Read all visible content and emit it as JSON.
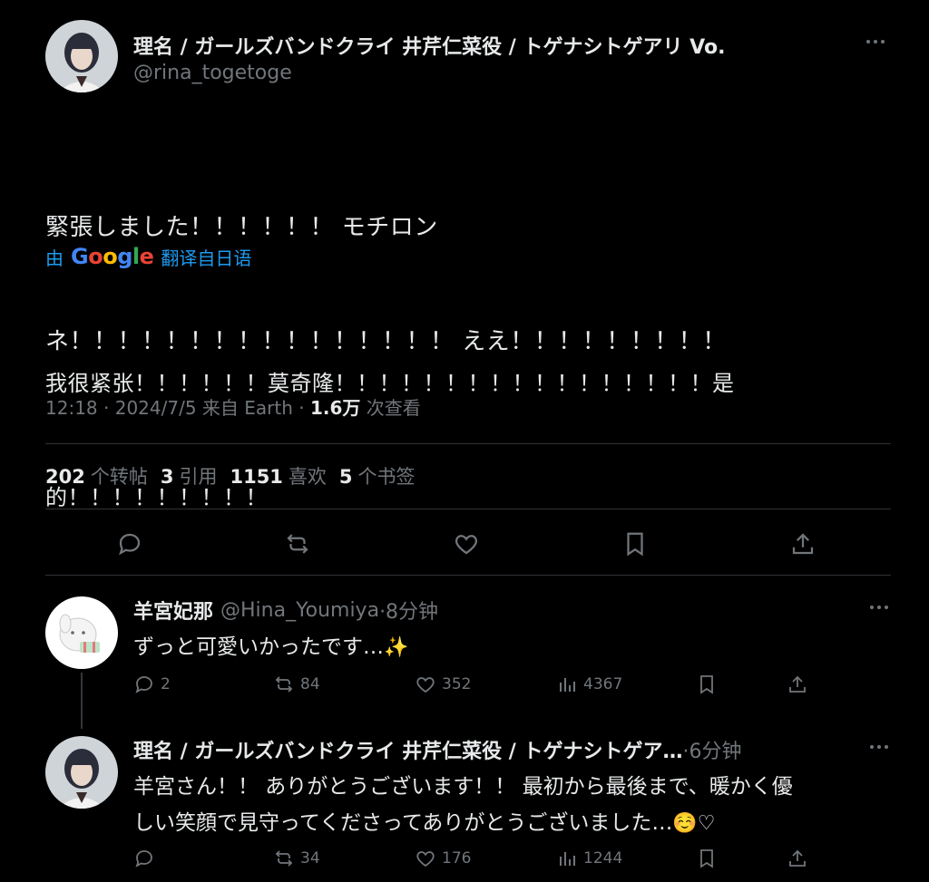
{
  "main_tweet": {
    "display_name": "理名 / ガールズバンドクライ 井芹仁菜役 / トゲナシトゲアリ Vo.",
    "handle": "@rina_togetoge",
    "text_line1": "緊張しました！！！！！！ モチロン",
    "text_line2": "ネ！！！！！！！！！！！！！！！！ ええ！！！！！！！！！",
    "translate": {
      "prefix": "由",
      "google": [
        "G",
        "o",
        "o",
        "g",
        "l",
        "e"
      ],
      "suffix": "翻译自日语"
    },
    "translated_line1": "我很紧张！！！！！！莫奇隆！！！！！！！！！！！！！！！！！是",
    "translated_line2": "的！！！！！！！！！",
    "meta": {
      "time": "12:18",
      "date": "2024/7/5",
      "source": "来自 Earth",
      "views_count": "1.6万",
      "views_label": "次查看"
    },
    "stats": [
      {
        "num": "202",
        "label": "个转帖"
      },
      {
        "num": "3",
        "label": "引用"
      },
      {
        "num": "1151",
        "label": "喜欢"
      },
      {
        "num": "5",
        "label": "个书签"
      }
    ]
  },
  "replies": [
    {
      "display_name": "羊宮妃那",
      "handle": "@Hina_Youmiya",
      "time": "·8分钟",
      "text": "ずっと可愛いかったです…",
      "emoji": "✨",
      "reply_count": "2",
      "retweet_count": "84",
      "like_count": "352",
      "view_count": "4367"
    },
    {
      "display_name": "理名 / ガールズバンドクライ 井芹仁菜役 / トゲナシトゲア…",
      "handle": "",
      "time": "·6分钟",
      "text_line1": "羊宮さん！！ ありがとうございます！！ 最初から最後まで、暖かく優",
      "text_line2": "しい笑顔で見守ってくださってありがとうございました…",
      "emoji": "☺️♡",
      "reply_count": "",
      "retweet_count": "34",
      "like_count": "176",
      "view_count": "1244"
    }
  ],
  "colors": {
    "background": "#000000",
    "text": "#e7e9ea",
    "muted": "#71767b",
    "link": "#1d9bf0",
    "divider": "#2f3336"
  }
}
